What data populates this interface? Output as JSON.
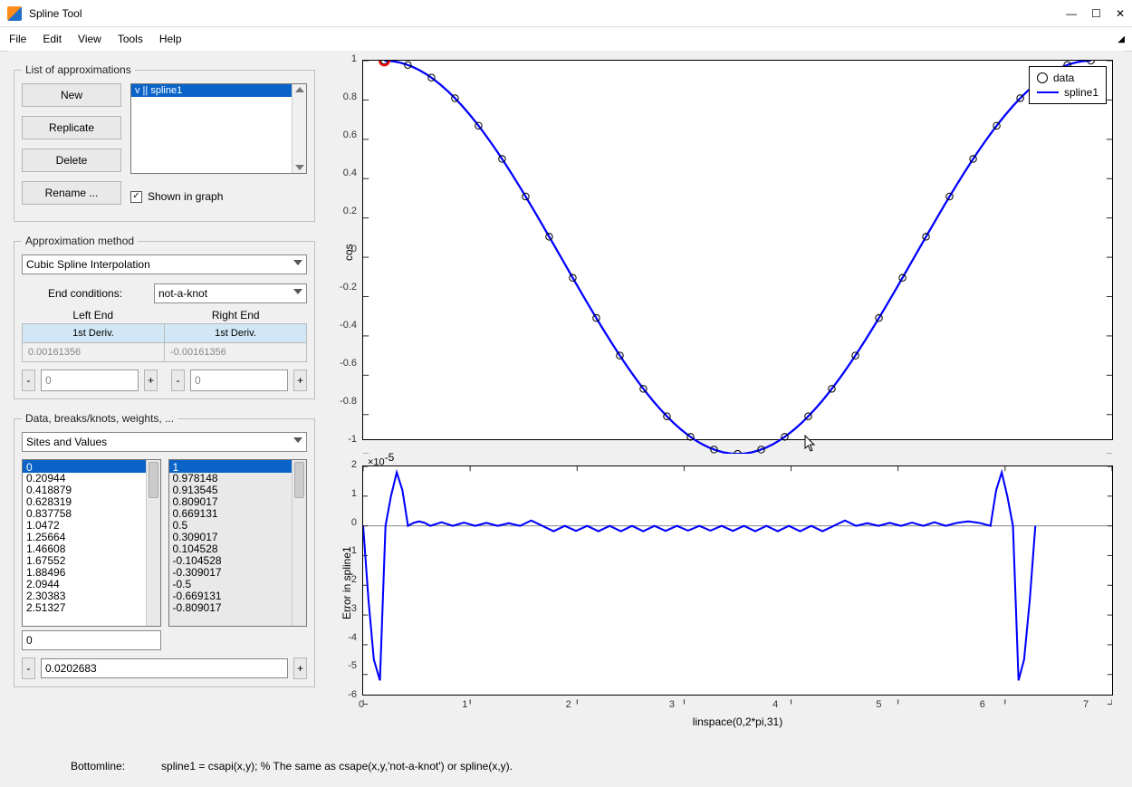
{
  "window": {
    "title": "Spline Tool"
  },
  "menu": {
    "file": "File",
    "edit": "Edit",
    "view": "View",
    "tools": "Tools",
    "help": "Help"
  },
  "approxlist": {
    "legend": "List of approximations",
    "new_btn": "New",
    "replicate_btn": "Replicate",
    "delete_btn": "Delete",
    "rename_btn": "Rename ...",
    "items": [
      "v || spline1"
    ],
    "shown_label": "Shown in graph",
    "shown_checked": true
  },
  "method": {
    "legend": "Approximation method",
    "primary": "Cubic Spline Interpolation",
    "end_conditions_label": "End conditions:",
    "end_conditions_value": "not-a-knot",
    "left_end_label": "Left End",
    "right_end_label": "Right End",
    "left_deriv": "1st Deriv.",
    "right_deriv": "1st Deriv.",
    "left_val": "0.00161356",
    "right_val": "-0.00161356",
    "spin_left": "0",
    "spin_right": "0"
  },
  "datapanel": {
    "legend": "Data, breaks/knots, weights, ...",
    "selector": "Sites and Values",
    "sites_header": "0",
    "values_header": "1",
    "sites": [
      "0.20944",
      "0.418879",
      "0.628319",
      "0.837758",
      "1.0472",
      "1.25664",
      "1.46608",
      "1.67552",
      "1.88496",
      "2.0944",
      "2.30383",
      "2.51327"
    ],
    "values": [
      "0.978148",
      "0.913545",
      "0.809017",
      "0.669131",
      "0.5",
      "0.309017",
      "0.104528",
      "-0.104528",
      "-0.309017",
      "-0.5",
      "-0.669131",
      "-0.809017"
    ],
    "edit_site": "0",
    "step_label": "0.0202683"
  },
  "bottomline": {
    "label": "Bottomline:",
    "text": "spline1 = csapi(x,y); % The same as csape(x,y,'not-a-knot') or spline(x,y)."
  },
  "chart_data": [
    {
      "type": "line",
      "title": "",
      "xlabel": "",
      "ylabel": "cos",
      "xlim": [
        0,
        6.2832
      ],
      "ylim": [
        -1,
        1
      ],
      "yticks": [
        -1,
        -0.8,
        -0.6,
        -0.4,
        -0.2,
        0,
        0.2,
        0.4,
        0.6,
        0.8,
        1
      ],
      "legend": [
        "data",
        "spline1"
      ],
      "series": [
        {
          "name": "data",
          "style": "markers-circle",
          "x": [
            0,
            0.20944,
            0.41888,
            0.62832,
            0.83776,
            1.0472,
            1.25664,
            1.46608,
            1.67552,
            1.88496,
            2.0944,
            2.30383,
            2.51327,
            2.72271,
            2.93215,
            3.14159,
            3.35103,
            3.56047,
            3.76991,
            3.97935,
            4.18879,
            4.39823,
            4.60767,
            4.81711,
            5.02655,
            5.23599,
            5.44543,
            5.65487,
            5.86431,
            6.07375,
            6.28319
          ],
          "y": [
            1,
            0.97815,
            0.91355,
            0.80902,
            0.66913,
            0.5,
            0.30902,
            0.10453,
            -0.10453,
            -0.30902,
            -0.5,
            -0.66913,
            -0.80902,
            -0.91355,
            -0.97815,
            -1,
            -0.97815,
            -0.91355,
            -0.80902,
            -0.66913,
            -0.5,
            -0.30902,
            -0.10453,
            0.10453,
            0.30902,
            0.5,
            0.66913,
            0.80902,
            0.91355,
            0.97815,
            1
          ]
        },
        {
          "name": "spline1",
          "style": "line",
          "color": "#0000ff",
          "x": [
            0,
            0.06283,
            0.12566,
            0.1885,
            0.25133,
            0.31416,
            0.37699,
            0.43982,
            0.50265,
            0.56549,
            0.62832,
            0.69115,
            0.75398,
            0.81681,
            0.87965,
            0.94248,
            1.0053,
            1.0681,
            1.131,
            1.1938,
            1.2566,
            1.3195,
            1.3823,
            1.4451,
            1.508,
            1.5708,
            1.6336,
            1.6965,
            1.7593,
            1.8221,
            1.885,
            1.9478,
            2.0106,
            2.0735,
            2.1363,
            2.1991,
            2.2619,
            2.3248,
            2.3876,
            2.4504,
            2.5133,
            2.5761,
            2.6389,
            2.7018,
            2.7646,
            2.8274,
            2.8903,
            2.9531,
            3.0159,
            3.0788,
            3.1416,
            3.2044,
            3.2673,
            3.3301,
            3.3929,
            3.4558,
            3.5186,
            3.5814,
            3.6442,
            3.7071,
            3.7699,
            3.8327,
            3.8956,
            3.9584,
            4.0212,
            4.0841,
            4.1469,
            4.2097,
            4.2726,
            4.3354,
            4.3982,
            4.4611,
            4.5239,
            4.5867,
            4.6496,
            4.7124,
            4.7752,
            4.8381,
            4.9009,
            4.9637,
            5.0265,
            5.0894,
            5.1522,
            5.215,
            5.2779,
            5.3407,
            5.4035,
            5.4664,
            5.5292,
            5.592,
            5.6549,
            5.7177,
            5.7805,
            5.8434,
            5.9062,
            5.969,
            6.0319,
            6.0947,
            6.1575,
            6.2204,
            6.2832
          ],
          "y": [
            1,
            0.99803,
            0.99211,
            0.98229,
            0.96858,
            0.95106,
            0.92978,
            0.90483,
            0.87631,
            0.84433,
            0.80902,
            0.77051,
            0.72897,
            0.68455,
            0.63742,
            0.58779,
            0.53583,
            0.48175,
            0.42578,
            0.36812,
            0.30902,
            0.24869,
            0.18738,
            0.12533,
            0.06279,
            0,
            -0.06279,
            -0.12533,
            -0.18738,
            -0.24869,
            -0.30902,
            -0.36812,
            -0.42578,
            -0.48175,
            -0.53583,
            -0.58779,
            -0.63742,
            -0.68455,
            -0.72897,
            -0.77051,
            -0.80902,
            -0.84433,
            -0.87631,
            -0.90483,
            -0.92978,
            -0.95106,
            -0.96858,
            -0.98229,
            -0.99211,
            -0.99803,
            -1,
            -0.99803,
            -0.99211,
            -0.98229,
            -0.96858,
            -0.95106,
            -0.92978,
            -0.90483,
            -0.87631,
            -0.84433,
            -0.80902,
            -0.77051,
            -0.72897,
            -0.68455,
            -0.63742,
            -0.58779,
            -0.53583,
            -0.48175,
            -0.42578,
            -0.36812,
            -0.30902,
            -0.24869,
            -0.18738,
            -0.12533,
            -0.06279,
            0,
            0.06279,
            0.12533,
            0.18738,
            0.24869,
            0.30902,
            0.36812,
            0.42578,
            0.48175,
            0.53583,
            0.58779,
            0.63742,
            0.68455,
            0.72897,
            0.77051,
            0.80902,
            0.84433,
            0.87631,
            0.90483,
            0.92978,
            0.95106,
            0.96858,
            0.98229,
            0.99211,
            0.99803,
            1
          ]
        }
      ],
      "highlight_point": {
        "x": 0,
        "y": 1,
        "color": "#ff0000"
      }
    },
    {
      "type": "line",
      "title": "",
      "xlabel": "linspace(0,2*pi,31)",
      "ylabel": "Error in spline1",
      "xlim": [
        0,
        7
      ],
      "ylim": [
        -6,
        2
      ],
      "yscale": "1e-5",
      "annotation": "×10^{-5}",
      "xticks": [
        0,
        1,
        2,
        3,
        4,
        5,
        6,
        7
      ],
      "yticks": [
        -6,
        -5,
        -4,
        -3,
        -2,
        -1,
        0,
        1,
        2
      ],
      "series": [
        {
          "name": "error",
          "style": "line",
          "color": "#0000ff",
          "x": [
            0,
            0.05,
            0.1,
            0.157,
            0.209,
            0.26,
            0.314,
            0.367,
            0.419,
            0.471,
            0.524,
            0.576,
            0.628,
            0.733,
            0.838,
            0.942,
            1.047,
            1.152,
            1.257,
            1.361,
            1.466,
            1.571,
            1.676,
            1.78,
            1.885,
            1.99,
            2.094,
            2.199,
            2.304,
            2.409,
            2.513,
            2.618,
            2.723,
            2.827,
            2.932,
            3.037,
            3.142,
            3.246,
            3.351,
            3.456,
            3.56,
            3.665,
            3.77,
            3.875,
            3.979,
            4.084,
            4.189,
            4.294,
            4.398,
            4.503,
            4.608,
            4.712,
            4.817,
            4.922,
            5.027,
            5.131,
            5.236,
            5.341,
            5.445,
            5.55,
            5.655,
            5.76,
            5.864,
            5.917,
            5.969,
            6.021,
            6.074,
            6.126,
            6.178,
            6.231,
            6.283
          ],
          "y_e5": [
            0,
            -2.5,
            -4.5,
            -5.2,
            0,
            1.0,
            1.8,
            1.2,
            0,
            0.1,
            0.15,
            0.1,
            0,
            0.12,
            0,
            0.11,
            0,
            0.1,
            0,
            0.09,
            0,
            0.18,
            0,
            -0.18,
            0,
            -0.17,
            0,
            -0.18,
            0,
            -0.18,
            0,
            -0.18,
            0,
            -0.17,
            0,
            -0.16,
            0,
            -0.16,
            0,
            -0.17,
            0,
            -0.18,
            0,
            -0.18,
            0,
            -0.18,
            0,
            -0.18,
            0,
            0.18,
            0,
            0.09,
            0,
            0.1,
            0,
            0.11,
            0,
            0.12,
            0,
            0.1,
            0.15,
            0.1,
            0,
            1.2,
            1.8,
            1.0,
            0,
            -5.2,
            -4.5,
            -2.5,
            0
          ]
        }
      ]
    }
  ]
}
